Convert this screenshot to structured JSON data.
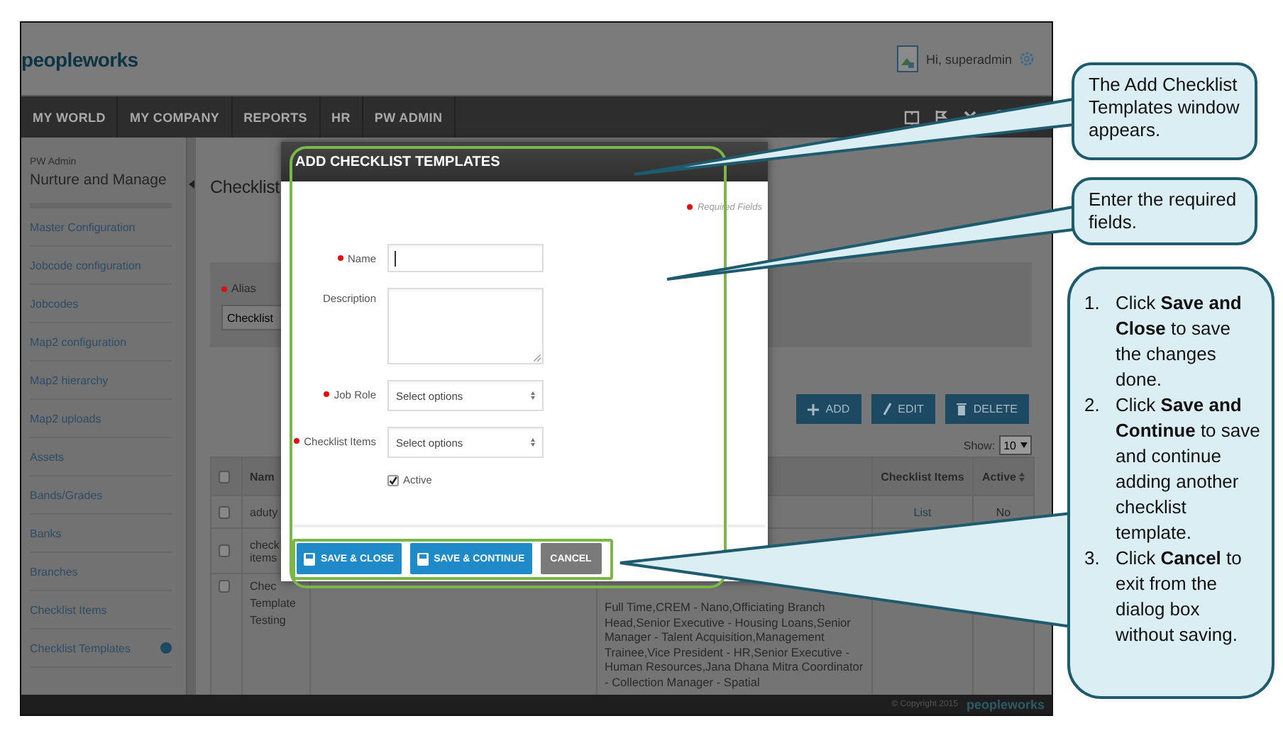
{
  "app": {
    "logo": "peopleworks",
    "greeting": "Hi, superadmin",
    "nav": [
      {
        "label": "MY WORLD"
      },
      {
        "label": "MY COMPANY"
      },
      {
        "label": "REPORTS"
      },
      {
        "label": "HR"
      },
      {
        "label": "PW ADMIN"
      }
    ],
    "sidebar": {
      "section": "PW Admin",
      "title": "Nurture and Manage",
      "items": [
        {
          "label": "Master Configuration",
          "selected": false
        },
        {
          "label": "Jobcode configuration",
          "selected": false
        },
        {
          "label": "Jobcodes",
          "selected": false
        },
        {
          "label": "Map2 configuration",
          "selected": false
        },
        {
          "label": "Map2 hierarchy",
          "selected": false
        },
        {
          "label": "Map2 uploads",
          "selected": false
        },
        {
          "label": "Assets",
          "selected": false
        },
        {
          "label": "Bands/Grades",
          "selected": false
        },
        {
          "label": "Banks",
          "selected": false
        },
        {
          "label": "Branches",
          "selected": false
        },
        {
          "label": "Checklist Items",
          "selected": false
        },
        {
          "label": "Checklist Templates",
          "selected": true
        }
      ]
    },
    "page_title": "Checklist",
    "filter": {
      "label": "Alias",
      "required": true,
      "value": "Checklist"
    },
    "actions": [
      {
        "kind": "add",
        "label": "ADD"
      },
      {
        "kind": "edit",
        "label": "EDIT"
      },
      {
        "kind": "delete",
        "label": "DELETE"
      }
    ],
    "show": {
      "label": "Show:",
      "value": "10"
    },
    "table": {
      "all_checked": false,
      "columns": [
        {
          "label": "Nam",
          "sortable": false
        },
        {
          "label": "Checklist Items",
          "sortable": false
        },
        {
          "label": "Active",
          "sortable": true
        }
      ],
      "rows": [
        {
          "checked": false,
          "name": "aduty",
          "checklist_items": "List",
          "active": "No"
        },
        {
          "checked": false,
          "name": "check items"
        },
        {
          "checked": false,
          "name": "Chec Template Testing",
          "column_4": "Full Time,CREM - Nano,Officiating Branch Head,Senior Executive - Housing Loans,Senior Manager - Talent Acquisition,Management Trainee,Vice President - HR,Senior Executive - Human Resources,Jana Dhana Mitra Coordinator - Collection Manager - Spatial"
        }
      ]
    },
    "footer": {
      "copyright": "© Copyright 2015",
      "logo": "peopleworks"
    }
  },
  "dialog": {
    "title": "ADD CHECKLIST TEMPLATES",
    "required_note": "Required Fields",
    "fields": [
      {
        "kind": "text",
        "label": "Name",
        "required": true,
        "focused": true
      },
      {
        "kind": "textarea",
        "label": "Description",
        "required": false
      },
      {
        "kind": "select",
        "label": "Job Role",
        "required": true,
        "value": "Select options"
      },
      {
        "kind": "select",
        "label": "Checklist Items",
        "required": true,
        "value": "Select options"
      },
      {
        "kind": "checkbox",
        "label": "Active",
        "checked": true
      }
    ],
    "buttons": [
      {
        "kind": "primary",
        "label": "SAVE & CLOSE"
      },
      {
        "kind": "primary",
        "label": "SAVE & CONTINUE"
      },
      {
        "kind": "secondary",
        "label": "CANCEL"
      }
    ]
  },
  "callouts": [
    {
      "kind": "note",
      "text": "The Add Checklist Templates window appears."
    },
    {
      "kind": "note",
      "text": "Enter the required fields."
    },
    {
      "kind": "steps",
      "steps": [
        {
          "number": "1.",
          "text": "Click **Save and Close** to save the changes done."
        },
        {
          "number": "2.",
          "text": "Click **Save and Continue** to save and continue adding another checklist template."
        },
        {
          "number": "3.",
          "text": "Click **Cancel** to exit from the dialog box without saving."
        }
      ]
    }
  ]
}
